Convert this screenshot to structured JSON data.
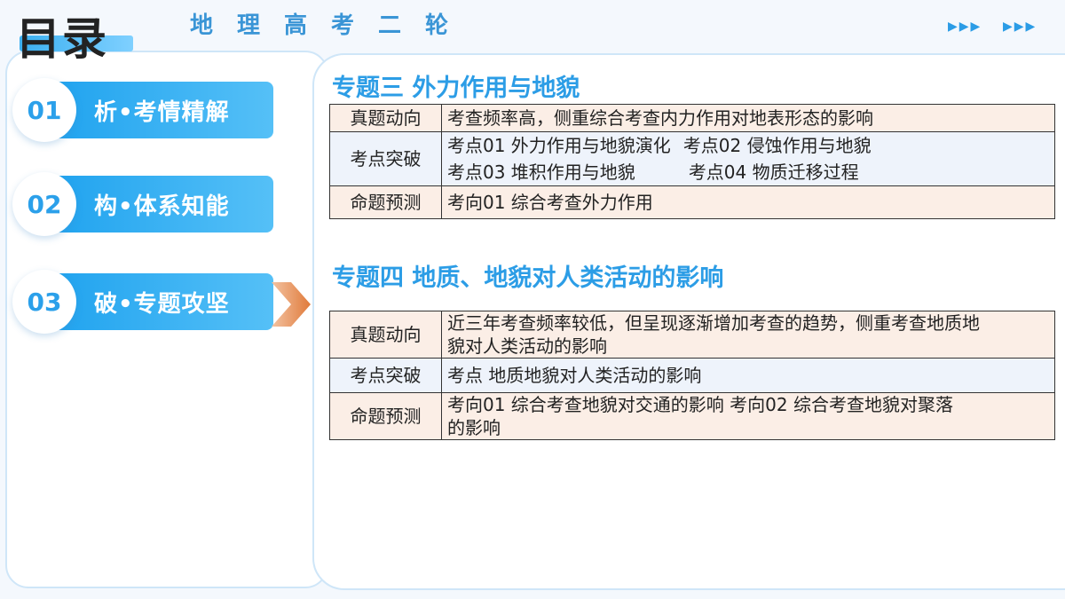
{
  "header": {
    "title": "目录",
    "subtitle": "地理高考二轮",
    "arrows": [
      "▶▶▶",
      "▶▶▶"
    ]
  },
  "nav": [
    {
      "number": "01",
      "label": "析•考情精解"
    },
    {
      "number": "02",
      "label": "构•体系知能"
    },
    {
      "number": "03",
      "label": "破•专题攻坚",
      "active": true
    }
  ],
  "topics": [
    {
      "heading": "专题三  外力作用与地貌",
      "rows": [
        {
          "label": "真题动向",
          "lines": [
            "考查频率高，侧重综合考查内力作用对地表形态的影响"
          ]
        },
        {
          "label": "考点突破",
          "points": [
            [
              "考点01 外力作用与地貌演化",
              "考点02 侵蚀作用与地貌"
            ],
            [
              "考点03 堆积作用与地貌",
              "考点04 物质迁移过程"
            ]
          ]
        },
        {
          "label": "命题预测",
          "lines": [
            "考向01  综合考查外力作用"
          ]
        }
      ]
    },
    {
      "heading": "专题四  地质、地貌对人类活动的影响",
      "rows": [
        {
          "label": "真题动向",
          "lines": [
            "近三年考查频率较低，但呈现逐渐增加考查的趋势，侧重考查地质地",
            "貌对人类活动的影响"
          ]
        },
        {
          "label": "考点突破",
          "lines": [
            "考点  地质地貌对人类活动的影响"
          ]
        },
        {
          "label": "命题预测",
          "lines": [
            "考向01 综合考查地貌对交通的影响   考向02  综合考查地貌对聚落",
            "的影响"
          ]
        }
      ]
    }
  ],
  "colors": {
    "accent": "#2c9de6",
    "nav_gradient_start": "#22a4ef",
    "nav_gradient_end": "#55c0f7",
    "row_peach": "#fbeee6",
    "row_blue": "#eef3fb",
    "arrow_orange": "#e07a3a"
  }
}
